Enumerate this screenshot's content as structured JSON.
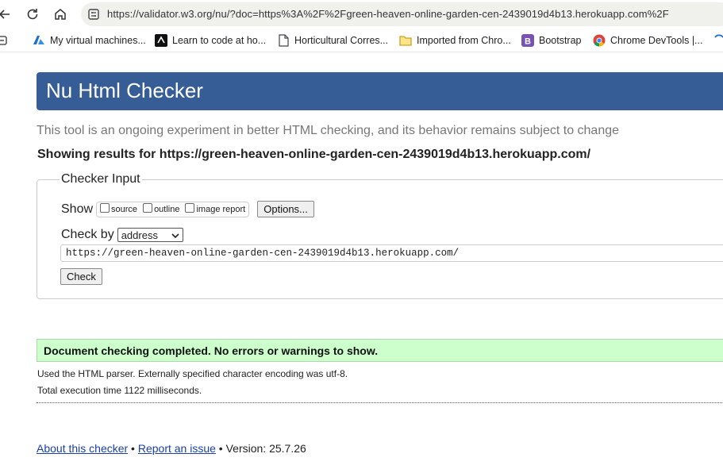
{
  "browser": {
    "url": "https://validator.w3.org/nu/?doc=https%3A%2F%2Fgreen-heaven-online-garden-cen-2439019d4b13.herokuapp.com%2F",
    "bookmarks": [
      {
        "label": "My virtual machines...",
        "icon": "azure-icon"
      },
      {
        "label": "Learn to code at ho...",
        "icon": "codeinstitute-icon"
      },
      {
        "label": "Horticultural Corres...",
        "icon": "document-icon"
      },
      {
        "label": "Imported from Chro...",
        "icon": "folder-icon"
      },
      {
        "label": "Bootstrap",
        "icon": "bootstrap-icon"
      },
      {
        "label": "Chrome DevTools |...",
        "icon": "chrome-icon"
      }
    ]
  },
  "page": {
    "title": "Nu Html Checker",
    "intro": "This tool is an ongoing experiment in better HTML checking, and its behavior remains subject to change",
    "showing": "Showing results for https://green-heaven-online-garden-cen-2439019d4b13.herokuapp.com/",
    "checker": {
      "legend": "Checker Input",
      "show_label": "Show",
      "options": [
        "source",
        "outline",
        "image report"
      ],
      "options_button": "Options...",
      "check_by_label": "Check by",
      "check_by_value": "address",
      "url_value": "https://green-heaven-online-garden-cen-2439019d4b13.herokuapp.com/",
      "check_button": "Check"
    },
    "result": {
      "success": "Document checking completed. No errors or warnings to show.",
      "parser_note": "Used the HTML parser. Externally specified character encoding was utf-8.",
      "time_note": "Total execution time 1122 milliseconds."
    },
    "footer": {
      "about": "About this checker",
      "sep1": " • ",
      "report": "Report an issue",
      "version": " • Version: 25.7.26"
    }
  },
  "colors": {
    "title_bar": "#365d95",
    "success_bg": "#ccffcc",
    "link": "#1a3fa8"
  }
}
